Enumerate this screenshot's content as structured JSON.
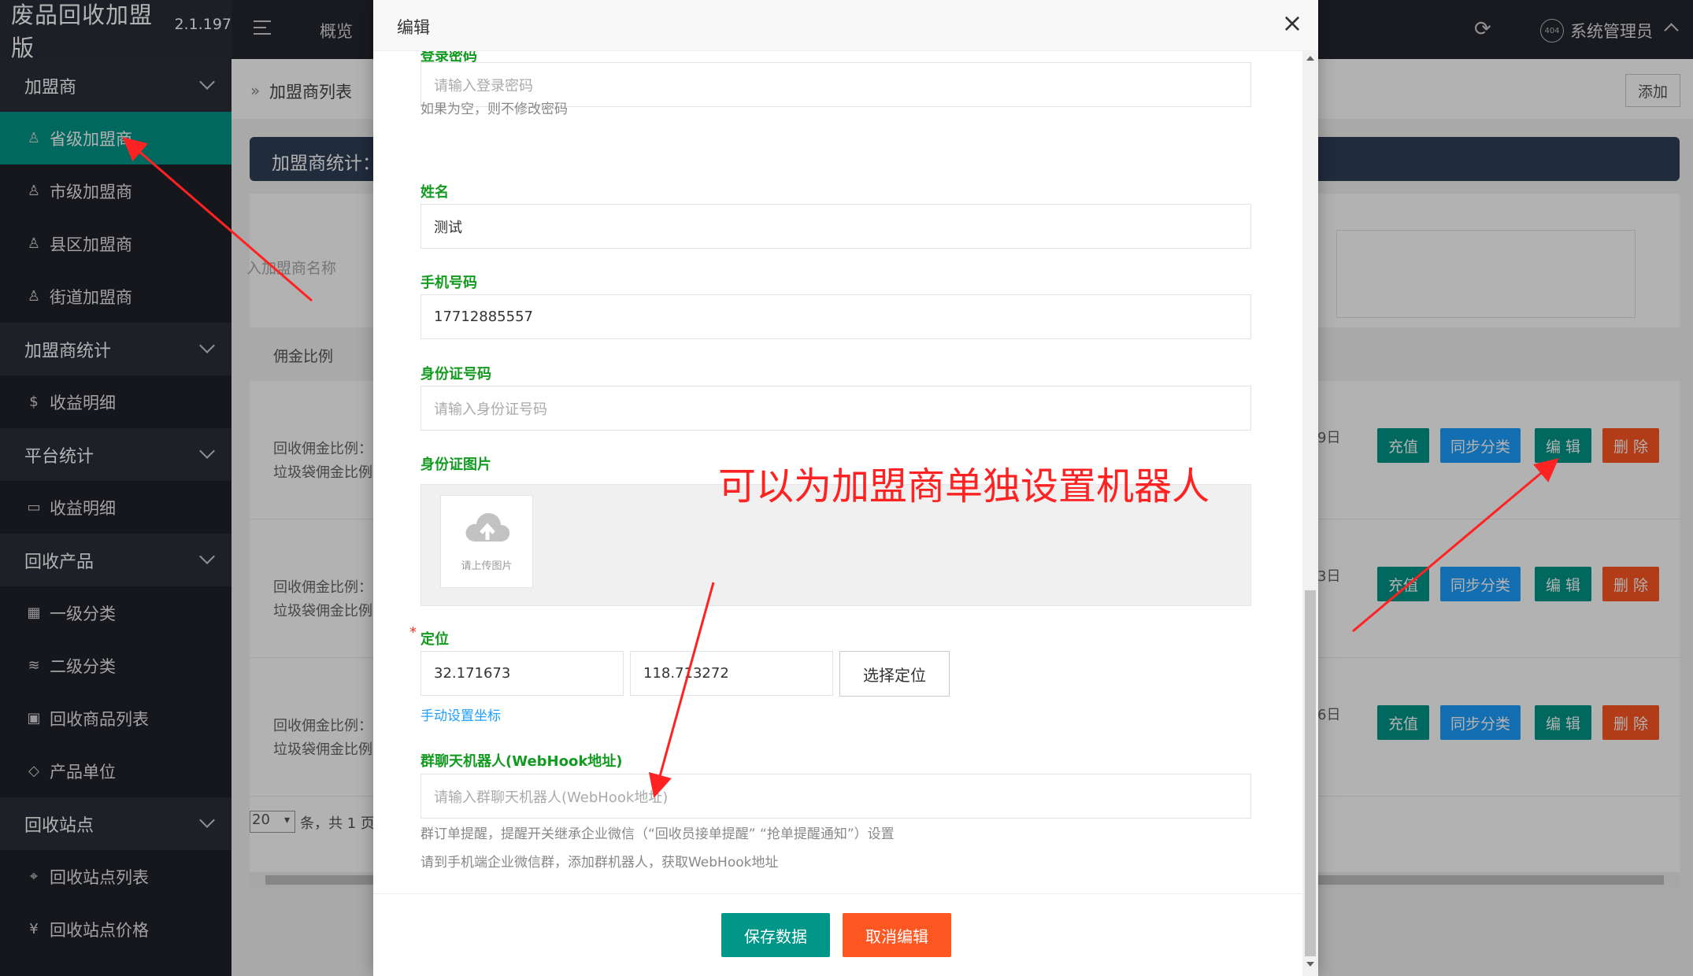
{
  "app": {
    "name": "废品回收加盟版",
    "version": "2.1.197"
  },
  "sidebar": {
    "items": [
      {
        "type": "group",
        "label": "加盟商",
        "icon": "chevron-down-icon"
      },
      {
        "type": "item",
        "label": "省级加盟商",
        "icon": "user-icon",
        "active": true
      },
      {
        "type": "item",
        "label": "市级加盟商",
        "icon": "user-icon"
      },
      {
        "type": "item",
        "label": "县区加盟商",
        "icon": "user-icon"
      },
      {
        "type": "item",
        "label": "街道加盟商",
        "icon": "user-icon"
      },
      {
        "type": "group",
        "label": "加盟商统计",
        "icon": "chevron-down-icon"
      },
      {
        "type": "item",
        "label": "收益明细",
        "icon": "dollar-icon"
      },
      {
        "type": "group",
        "label": "平台统计",
        "icon": "chevron-down-icon"
      },
      {
        "type": "item",
        "label": "收益明细",
        "icon": "book-icon"
      },
      {
        "type": "group",
        "label": "回收产品",
        "icon": "chevron-down-icon"
      },
      {
        "type": "item",
        "label": "一级分类",
        "icon": "grid-icon"
      },
      {
        "type": "item",
        "label": "二级分类",
        "icon": "layers-icon"
      },
      {
        "type": "item",
        "label": "回收商品列表",
        "icon": "apps-icon"
      },
      {
        "type": "item",
        "label": "产品单位",
        "icon": "diamond-icon"
      },
      {
        "type": "group",
        "label": "回收站点",
        "icon": "chevron-down-icon"
      },
      {
        "type": "item",
        "label": "回收站点列表",
        "icon": "location-icon"
      },
      {
        "type": "item",
        "label": "回收站点价格",
        "icon": "yen-icon"
      }
    ]
  },
  "header": {
    "nav_overview": "概览",
    "user_badge": "404",
    "user_name": "系统管理员"
  },
  "background": {
    "breadcrumb": "加盟商列表",
    "add_button": "添加",
    "stats_title": "加盟商统计：",
    "search_placeholder": "入加盟商名称",
    "table_header": "佣金比例",
    "rows": [
      {
        "line1": "回收佣金比例：(",
        "line2": "垃圾袋佣金比例",
        "date": "9日"
      },
      {
        "line1": "回收佣金比例：(",
        "line2": "垃圾袋佣金比例",
        "date": "3日"
      },
      {
        "line1": "回收佣金比例：-",
        "line2": "垃圾袋佣金比例",
        "date": "6日"
      }
    ],
    "row_buttons": {
      "charge": "充值",
      "sync": "同步分类",
      "edit": "编 辑",
      "delete": "删 除"
    },
    "pager_size": "20",
    "pager_text": "条，共 1 页"
  },
  "modal": {
    "title": "编辑",
    "close": "×",
    "password": {
      "label": "登录密码",
      "placeholder": "请输入登录密码",
      "help": "如果为空，则不修改密码"
    },
    "name": {
      "label": "姓名",
      "value": "测试"
    },
    "phone": {
      "label": "手机号码",
      "value": "17712885557"
    },
    "idcard": {
      "label": "身份证号码",
      "placeholder": "请输入身份证号码"
    },
    "idimage": {
      "label": "身份证图片",
      "upload_text": "请上传图片"
    },
    "location": {
      "label": "定位",
      "lat": "32.171673",
      "lng": "118.713272",
      "pick_button": "选择定位",
      "manual_link": "手动设置坐标"
    },
    "webhook": {
      "label": "群聊天机器人(WebHook地址)",
      "placeholder": "请输入群聊天机器人(WebHook地址)",
      "help1": "群订单提醒，提醒开关继承企业微信（“回收员接单提醒” “抢单提醒通知”）设置",
      "help2": "请到手机端企业微信群，添加群机器人，获取WebHook地址"
    },
    "save_button": "保存数据",
    "cancel_button": "取消编辑"
  },
  "annotation": {
    "text": "可以为加盟商单独设置机器人",
    "color": "#ff2222"
  },
  "colors": {
    "accent": "#009688",
    "blue": "#1e9fff",
    "danger": "#ff5722",
    "label_green": "#129b20",
    "sidebar": "#20222a"
  }
}
